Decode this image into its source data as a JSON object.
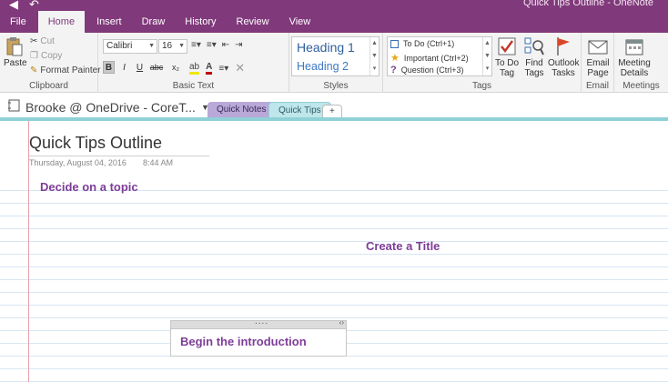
{
  "window": {
    "title": "Quick Tips Outline - OneNote"
  },
  "ribbon_tabs": [
    "File",
    "Home",
    "Insert",
    "Draw",
    "History",
    "Review",
    "View"
  ],
  "clipboard": {
    "paste": "Paste",
    "cut": "Cut",
    "copy": "Copy",
    "format_painter": "Format Painter",
    "label": "Clipboard"
  },
  "basic_text": {
    "font": "Calibri",
    "size": "16",
    "bold": "B",
    "italic": "I",
    "underline": "U",
    "strike": "abc",
    "subscript": "x₂",
    "label": "Basic Text"
  },
  "styles": {
    "heading1": "Heading 1",
    "heading2": "Heading 2",
    "label": "Styles"
  },
  "tags": {
    "items": [
      {
        "label": "To Do (Ctrl+1)"
      },
      {
        "label": "Important (Ctrl+2)"
      },
      {
        "label": "Question (Ctrl+3)"
      }
    ],
    "todo_tag": "To Do Tag",
    "find_tags": "Find Tags",
    "outlook_tasks": "Outlook Tasks",
    "label": "Tags"
  },
  "email": {
    "email_page": "Email Page",
    "label": "Email"
  },
  "meetings": {
    "meeting_details": "Meeting Details",
    "label": "Meetings"
  },
  "notebook": {
    "name": "Brooke @ OneDrive - CoreT...",
    "sections": [
      "Quick Notes",
      "Quick Tips"
    ],
    "add_section": "+"
  },
  "page": {
    "title": "Quick Tips Outline",
    "date": "Thursday, August 04, 2016",
    "time": "8:44 AM",
    "notes": [
      "Decide on a topic",
      "Create a Title",
      "Begin the introduction"
    ]
  },
  "colors": {
    "accent": "#80397B",
    "note_text": "#7D3D97"
  }
}
